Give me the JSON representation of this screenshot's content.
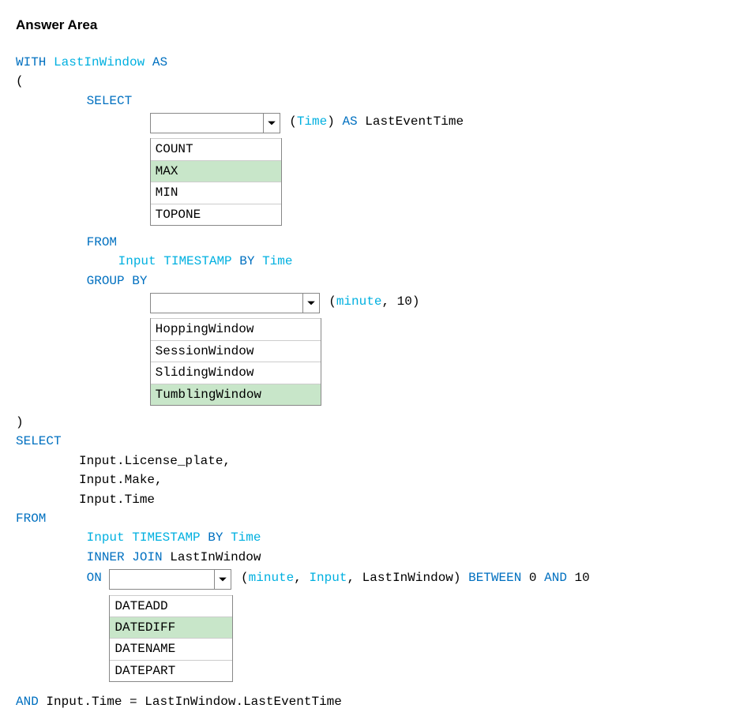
{
  "header": {
    "title": "Answer Area"
  },
  "code": {
    "l1": {
      "with": "WITH",
      "name": "LastInWindow",
      "as": "AS"
    },
    "l2": "(",
    "select": "SELECT",
    "dd1_after": {
      "open": " (",
      "time": "Time",
      "close": ") ",
      "as": "AS",
      "rest": " LastEventTime"
    },
    "from1": "FROM",
    "from1_body": {
      "a": "Input",
      "b": "TIMESTAMP",
      "c": "BY",
      "d": "Time"
    },
    "groupby": "GROUP BY",
    "dd2_after": {
      "open": " (",
      "minute": "minute",
      "rest": ", 10)"
    },
    "close": ")",
    "select2": "SELECT",
    "sel_lines": [
      "Input.License_plate,",
      "Input.Make,",
      "Input.Time"
    ],
    "from2": "FROM",
    "from2_body1": {
      "a": "Input",
      "b": "TIMESTAMP",
      "c": "BY",
      "d": "Time"
    },
    "from2_body2": {
      "a": "INNER",
      "b": "JOIN",
      "c": " LastInWindow"
    },
    "on": "ON",
    "dd3_after": {
      "open": " (",
      "minute": "minute",
      "mid1": ", ",
      "input": "Input",
      "mid2": ", LastInWindow) ",
      "between": "BETWEEN",
      "zero": " 0 ",
      "and": "AND",
      "ten": " 10"
    },
    "last": {
      "and": "AND",
      "rest": " Input.Time = LastInWindow.LastEventTime"
    }
  },
  "dropdowns": {
    "dd1": {
      "value": "",
      "options": [
        "COUNT",
        "MAX",
        "MIN",
        "TOPONE"
      ],
      "selected": "MAX"
    },
    "dd2": {
      "value": "",
      "options": [
        "HoppingWindow",
        "SessionWindow",
        "SlidingWindow",
        "TumblingWindow"
      ],
      "selected": "TumblingWindow"
    },
    "dd3": {
      "value": "",
      "options": [
        "DATEADD",
        "DATEDIFF",
        "DATENAME",
        "DATEPART"
      ],
      "selected": "DATEDIFF"
    }
  }
}
